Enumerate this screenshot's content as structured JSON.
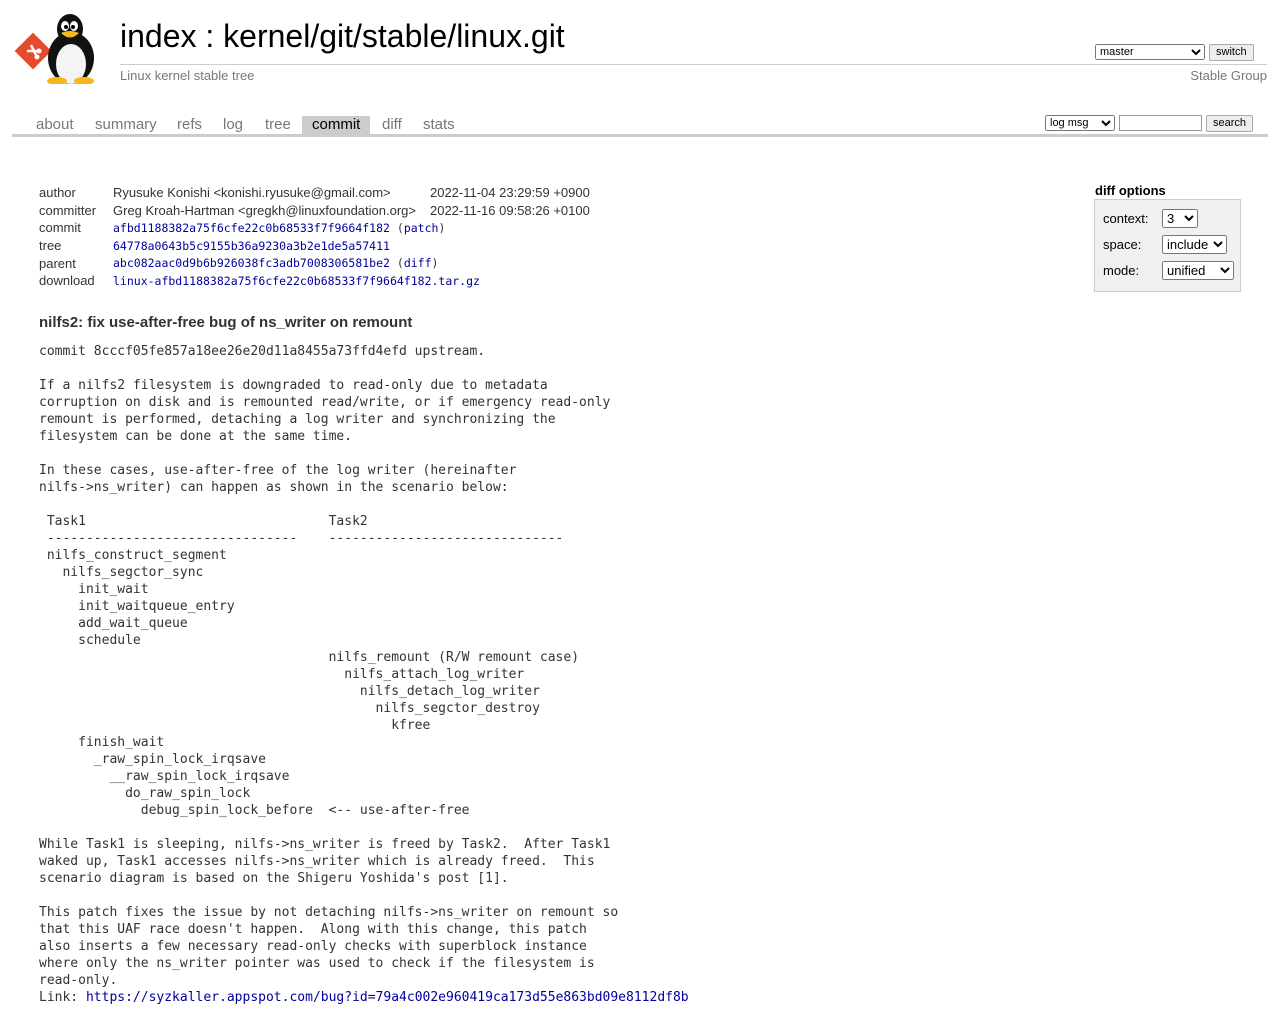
{
  "header": {
    "index_link": "index",
    "separator": " : ",
    "repo_path": "kernel/git/stable/linux.git",
    "subtitle": "Linux kernel stable tree",
    "owner": "Stable Group",
    "branch_selected": "master",
    "switch_label": "switch"
  },
  "tabs": [
    {
      "label": "about"
    },
    {
      "label": "summary"
    },
    {
      "label": "refs"
    },
    {
      "label": "log"
    },
    {
      "label": "tree"
    },
    {
      "label": "commit",
      "active": true
    },
    {
      "label": "diff"
    },
    {
      "label": "stats"
    }
  ],
  "search": {
    "scope_selected": "log msg",
    "query": "",
    "button_label": "search"
  },
  "commit_info": {
    "author_label": "author",
    "author": "Ryusuke Konishi <konishi.ryusuke@gmail.com>",
    "author_date": "2022-11-04 23:29:59 +0900",
    "committer_label": "committer",
    "committer": "Greg Kroah-Hartman <gregkh@linuxfoundation.org>",
    "committer_date": "2022-11-16 09:58:26 +0100",
    "commit_label": "commit",
    "commit_hash": "afbd1188382a75f6cfe22c0b68533f7f9664f182",
    "patch_link": "patch",
    "tree_label": "tree",
    "tree_hash": "64778a0643b5c9155b36a9230a3b2e1de5a57411",
    "parent_label": "parent",
    "parent_hash": "abc082aac0d9b6b926038fc3adb7008306581be2",
    "diff_link": "diff",
    "download_label": "download",
    "download_file": "linux-afbd1188382a75f6cfe22c0b68533f7f9664f182.tar.gz"
  },
  "diff_options": {
    "title": "diff options",
    "context_label": "context:",
    "context_value": "3",
    "space_label": "space:",
    "space_value": "include",
    "mode_label": "mode:",
    "mode_value": "unified"
  },
  "subject": "nilfs2: fix use-after-free bug of ns_writer on remount",
  "message": "commit 8cccf05fe857a18ee26e20d11a8455a73ffd4efd upstream.\n\nIf a nilfs2 filesystem is downgraded to read-only due to metadata\ncorruption on disk and is remounted read/write, or if emergency read-only\nremount is performed, detaching a log writer and synchronizing the\nfilesystem can be done at the same time.\n\nIn these cases, use-after-free of the log writer (hereinafter\nnilfs->ns_writer) can happen as shown in the scenario below:\n\n Task1                               Task2\n --------------------------------    ------------------------------\n nilfs_construct_segment\n   nilfs_segctor_sync\n     init_wait\n     init_waitqueue_entry\n     add_wait_queue\n     schedule\n                                     nilfs_remount (R/W remount case)\n                                       nilfs_attach_log_writer\n                                         nilfs_detach_log_writer\n                                           nilfs_segctor_destroy\n                                             kfree\n     finish_wait\n       _raw_spin_lock_irqsave\n         __raw_spin_lock_irqsave\n           do_raw_spin_lock\n             debug_spin_lock_before  <-- use-after-free\n\nWhile Task1 is sleeping, nilfs->ns_writer is freed by Task2.  After Task1\nwaked up, Task1 accesses nilfs->ns_writer which is already freed.  This\nscenario diagram is based on the Shigeru Yoshida's post [1].\n\nThis patch fixes the issue by not detaching nilfs->ns_writer on remount so\nthat this UAF race doesn't happen.  Along with this change, this patch\nalso inserts a few necessary read-only checks with superblock instance\nwhere only the ns_writer pointer was used to check if the filesystem is\nread-only.\n",
  "link": {
    "label": "Link: ",
    "url": "https://syzkaller.appspot.com/bug?id=79a4c002e960419ca173d55e863bd09e8112df8b"
  }
}
